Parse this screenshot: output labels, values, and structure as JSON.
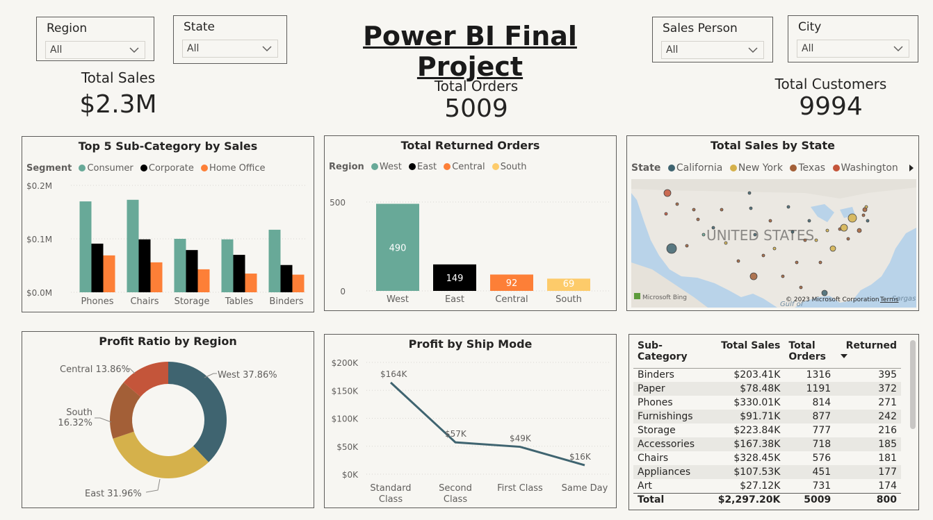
{
  "title": "Power BI Final Project",
  "slicers": {
    "region": {
      "label": "Region",
      "value": "All"
    },
    "state": {
      "label": "State",
      "value": "All"
    },
    "salesperson": {
      "label": "Sales Person",
      "value": "All"
    },
    "city": {
      "label": "City",
      "value": "All"
    }
  },
  "cards": {
    "sales": {
      "label": "Total Sales",
      "value": "$2.3M"
    },
    "orders": {
      "label": "Total Orders",
      "value": "5009"
    },
    "customers": {
      "label": "Total Customers",
      "value": "9994"
    }
  },
  "colors": {
    "consumer": "#68a998",
    "corporate": "#000000",
    "home_office": "#fd7f37",
    "west": "#68a998",
    "east": "#000000",
    "central": "#fd7f37",
    "south": "#fdcb6a"
  },
  "chart_data": [
    {
      "type": "bar",
      "title": "Top 5 Sub-Category by Sales",
      "legend_title": "Segment",
      "categories": [
        "Phones",
        "Chairs",
        "Storage",
        "Tables",
        "Binders"
      ],
      "series": [
        {
          "name": "Consumer",
          "color": "#68a998",
          "values": [
            0.17,
            0.173,
            0.1,
            0.099,
            0.117
          ]
        },
        {
          "name": "Corporate",
          "color": "#000000",
          "values": [
            0.091,
            0.099,
            0.079,
            0.07,
            0.051
          ]
        },
        {
          "name": "Home Office",
          "color": "#fd7f37",
          "values": [
            0.069,
            0.056,
            0.043,
            0.035,
            0.033
          ]
        }
      ],
      "yticks": [
        "$0.0M",
        "$0.1M",
        "$0.2M"
      ],
      "ylim": [
        0,
        0.2
      ]
    },
    {
      "type": "bar",
      "title": "Total Returned Orders",
      "legend_title": "Region",
      "categories": [
        "West",
        "East",
        "Central",
        "South"
      ],
      "values": [
        490,
        149,
        92,
        69
      ],
      "colors": [
        "#68a998",
        "#000000",
        "#fd7f37",
        "#fdcb6a"
      ],
      "labels": [
        "490",
        "149",
        "92",
        "69"
      ],
      "yticks": [
        "0",
        "500"
      ],
      "ylim": [
        0,
        500
      ]
    },
    {
      "type": "pie",
      "title": "Profit Ratio by Region",
      "slices": [
        {
          "name": "West",
          "value": 37.86,
          "label": "West 37.86%",
          "color": "#3f6470"
        },
        {
          "name": "East",
          "value": 31.96,
          "label": "East 31.96%",
          "color": "#d5b14b"
        },
        {
          "name": "South",
          "value": 16.32,
          "label_line1": "South",
          "label_line2": "16.32%",
          "color": "#a35f37"
        },
        {
          "name": "Central",
          "value": 13.86,
          "label": "Central 13.86%",
          "color": "#c4553a"
        }
      ]
    },
    {
      "type": "line",
      "title": "Profit by Ship Mode",
      "categories": [
        [
          "Standard",
          "Class"
        ],
        [
          "Second",
          "Class"
        ],
        [
          "First Class"
        ],
        [
          "Same Day"
        ]
      ],
      "values": [
        164,
        57,
        49,
        16
      ],
      "labels": [
        "$164K",
        "$57K",
        "$49K",
        "$16K"
      ],
      "yticks": [
        "$0K",
        "$50K",
        "$100K",
        "$150K",
        "$200K"
      ],
      "ylim": [
        0,
        200
      ],
      "color": "#3f6470"
    }
  ],
  "map": {
    "title": "Total Sales by State",
    "legend_title": "State",
    "legend": [
      {
        "name": "California",
        "color": "#3f6470"
      },
      {
        "name": "New York",
        "color": "#d5b14b"
      },
      {
        "name": "Texas",
        "color": "#a35f37"
      },
      {
        "name": "Washington",
        "color": "#c4553a"
      }
    ],
    "country_label": "UNITED STATES",
    "attribution": "Microsoft Bing",
    "copyright": "© 2023 Microsoft Corporation",
    "terms": "Terms",
    "gulf_label": "Gulf of",
    "extra_label": "Sargas"
  },
  "table": {
    "headers": [
      [
        "Sub-",
        "Category"
      ],
      [
        "Total Sales"
      ],
      [
        "Total",
        "Orders"
      ],
      [
        "Returned"
      ]
    ],
    "rows": [
      [
        "Binders",
        "$203.41K",
        "1316",
        "395"
      ],
      [
        "Paper",
        "$78.48K",
        "1191",
        "372"
      ],
      [
        "Phones",
        "$330.01K",
        "814",
        "271"
      ],
      [
        "Furnishings",
        "$91.71K",
        "877",
        "242"
      ],
      [
        "Storage",
        "$223.84K",
        "777",
        "216"
      ],
      [
        "Accessories",
        "$167.38K",
        "718",
        "185"
      ],
      [
        "Chairs",
        "$328.45K",
        "576",
        "181"
      ],
      [
        "Appliances",
        "$107.53K",
        "451",
        "177"
      ],
      [
        "Art",
        "$27.12K",
        "731",
        "174"
      ]
    ],
    "total": [
      "Total",
      "$2,297.20K",
      "5009",
      "800"
    ]
  }
}
